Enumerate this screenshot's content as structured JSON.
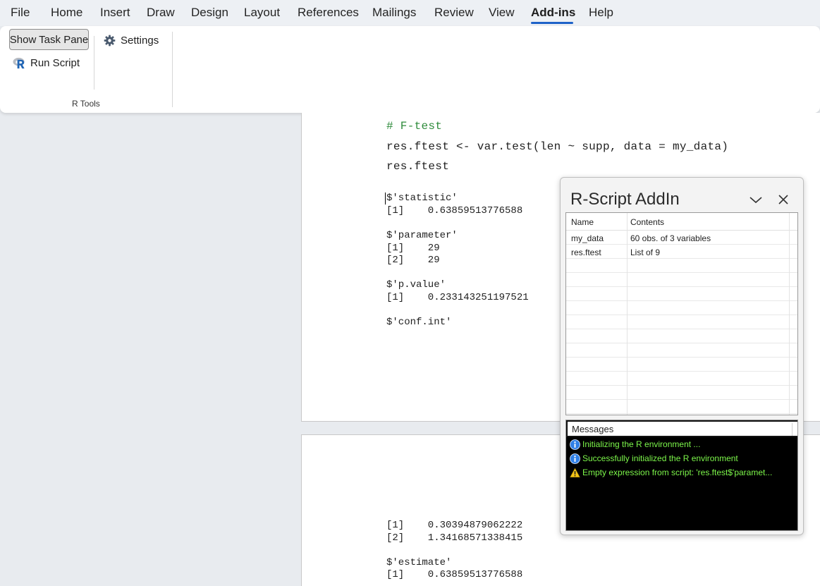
{
  "menu": {
    "items": [
      "File",
      "Home",
      "Insert",
      "Draw",
      "Design",
      "Layout",
      "References",
      "Mailings",
      "Review",
      "View",
      "Add-ins",
      "Help"
    ],
    "active": "Add-ins"
  },
  "ribbon": {
    "show_task_pane": "Show Task Pane",
    "run_script": "Run Script",
    "settings": "Settings",
    "group_label": "R Tools"
  },
  "document": {
    "code": {
      "comment": "# F-test",
      "line1": "res.ftest <- var.test(len ~ supp, data = my_data)",
      "line2": "res.ftest"
    },
    "output": {
      "statistic_label": "$'statistic'",
      "statistic_1": "[1]    0.63859513776588",
      "parameter_label": "$'parameter'",
      "parameter_1": "[1]    29",
      "parameter_2": "[2]    29",
      "pvalue_label": "$'p.value'",
      "pvalue_1": "[1]    0.233143251197521",
      "confint_label": "$'conf.int'",
      "confint_1": "[1]    0.30394879062222",
      "confint_2": "[2]    1.34168571338415",
      "estimate_label": "$'estimate'",
      "estimate_1": "[1]    0.63859513776588"
    }
  },
  "pane": {
    "title": "R-Script AddIn",
    "variables": {
      "columns": [
        "Name",
        "Contents"
      ],
      "rows": [
        {
          "name": "my_data",
          "contents": "60 obs. of 3 variables"
        },
        {
          "name": "res.ftest",
          "contents": "List of 9"
        }
      ]
    },
    "messages": {
      "header": "Messages",
      "items": [
        {
          "icon": "info-icon",
          "text": "Initializing the R environment ..."
        },
        {
          "icon": "info-icon",
          "text": "Successfully initialized the R environment"
        },
        {
          "icon": "warning-icon",
          "text": "Empty expression from script: 'res.ftest$'paramet..."
        }
      ]
    }
  },
  "colors": {
    "accent": "#1e62c8",
    "comment": "#2e8b3b",
    "message_text": "#7cf64a",
    "message_bg": "#000000"
  }
}
